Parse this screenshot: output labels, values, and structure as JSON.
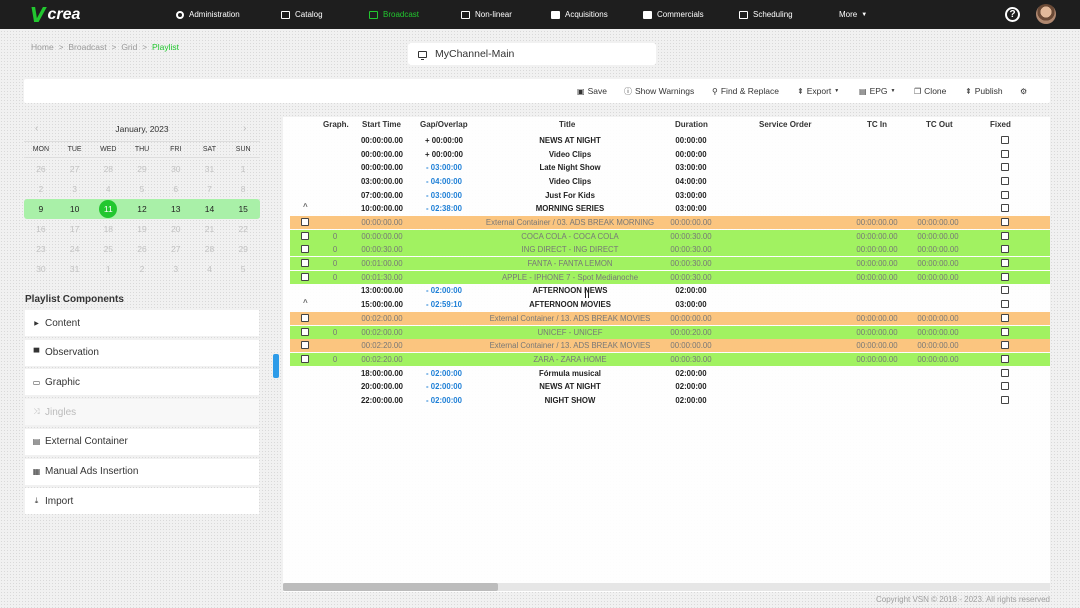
{
  "brand": {
    "logo_letter": "V",
    "logo_text": "crea",
    "accent": "#22c72f"
  },
  "nav": [
    {
      "label": "Administration",
      "icon": "gear-icon"
    },
    {
      "label": "Catalog",
      "icon": "folder-icon"
    },
    {
      "label": "Broadcast",
      "icon": "cast-icon",
      "active": true
    },
    {
      "label": "Non-linear",
      "icon": "play-icon"
    },
    {
      "label": "Acquisitions",
      "icon": "basket-icon"
    },
    {
      "label": "Commercials",
      "icon": "newspaper-icon"
    },
    {
      "label": "Scheduling",
      "icon": "calendar-icon"
    },
    {
      "label": "More",
      "icon": "caret-down-icon"
    }
  ],
  "help": {
    "label": "?"
  },
  "breadcrumb": {
    "home": "Home",
    "broadcast": "Broadcast",
    "grid": "Grid",
    "current": "Playlist",
    "sep": ">"
  },
  "channel": {
    "name": "MyChannel-Main"
  },
  "toolbar": {
    "save": "Save",
    "show_warnings": "Show Warnings",
    "find_replace": "Find & Replace",
    "export": "Export",
    "epg": "EPG",
    "clone": "Clone",
    "publish": "Publish"
  },
  "calendar": {
    "month": "January, 2023",
    "prev": "‹",
    "next": "›",
    "dow": [
      "MON",
      "TUE",
      "WED",
      "THU",
      "FRI",
      "SAT",
      "SUN"
    ],
    "weeks": [
      [
        "26",
        "27",
        "28",
        "29",
        "30",
        "31",
        "1"
      ],
      [
        "2",
        "3",
        "4",
        "5",
        "6",
        "7",
        "8"
      ],
      [
        "9",
        "10",
        "11",
        "12",
        "13",
        "14",
        "15"
      ],
      [
        "16",
        "17",
        "18",
        "19",
        "20",
        "21",
        "22"
      ],
      [
        "23",
        "24",
        "25",
        "26",
        "27",
        "28",
        "29"
      ],
      [
        "30",
        "31",
        "1",
        "2",
        "3",
        "4",
        "5"
      ]
    ],
    "selected_week": 2,
    "today": "11"
  },
  "components": {
    "title": "Playlist Components",
    "items": [
      {
        "label": "Content",
        "icon": "caret-right-icon"
      },
      {
        "label": "Observation",
        "icon": "comment-icon"
      },
      {
        "label": "Graphic",
        "icon": "monitor-icon"
      },
      {
        "label": "Jingles",
        "icon": "shuffle-icon",
        "disabled": true
      },
      {
        "label": "External Container",
        "icon": "container-icon"
      },
      {
        "label": "Manual Ads Insertion",
        "icon": "calendar-icon"
      },
      {
        "label": "Import",
        "icon": "download-icon"
      }
    ]
  },
  "grid": {
    "columns": {
      "graph": "Graph.",
      "start": "Start Time",
      "gap": "Gap/Overlap",
      "title": "Title",
      "duration": "Duration",
      "service": "Service Order",
      "tcin": "TC In",
      "tcout": "TC Out",
      "fixed": "Fixed"
    },
    "rows": [
      {
        "type": "plain",
        "start": "00:00:00.00",
        "gap": "+ 00:00:00",
        "title": "NEWS AT NIGHT",
        "duration": "00:00:00"
      },
      {
        "type": "plain",
        "start": "00:00:00.00",
        "gap": "+ 00:00:00",
        "title": "Video Clips",
        "duration": "00:00:00"
      },
      {
        "type": "plain",
        "start": "00:00:00.00",
        "gap": "- 03:00:00",
        "gap_blue": true,
        "title": "Late Night Show",
        "duration": "03:00:00"
      },
      {
        "type": "plain",
        "start": "03:00:00.00",
        "gap": "- 04:00:00",
        "gap_blue": true,
        "title": "Video Clips",
        "duration": "04:00:00"
      },
      {
        "type": "plain",
        "start": "07:00:00.00",
        "gap": "- 03:00:00",
        "gap_blue": true,
        "title": "Just For Kids",
        "duration": "03:00:00"
      },
      {
        "type": "plain",
        "start": "10:00:00.00",
        "gap": "- 02:38:00",
        "gap_blue": true,
        "title": "MORNING SERIES",
        "duration": "03:00:00",
        "chevron": "^"
      },
      {
        "type": "orange",
        "start": "00:00:00.00",
        "title": "External Container / 03. ADS BREAK MORNING",
        "duration": "00:00:00.00",
        "tcin": "00:00:00.00",
        "tcout": "00:00:00.00"
      },
      {
        "type": "green",
        "graph": "0",
        "start": "00:00:00.00",
        "title": "COCA COLA - COCA COLA",
        "duration": "00:00:30.00",
        "tcin": "00:00:00.00",
        "tcout": "00:00:00.00"
      },
      {
        "type": "green",
        "graph": "0",
        "start": "00:00:30.00",
        "title": "ING DIRECT - ING DIRECT",
        "duration": "00:00:30.00",
        "tcin": "00:00:00.00",
        "tcout": "00:00:00.00"
      },
      {
        "type": "green",
        "graph": "0",
        "start": "00:01:00.00",
        "title": "FANTA - FANTA LEMON",
        "duration": "00:00:30.00",
        "tcin": "00:00:00.00",
        "tcout": "00:00:00.00"
      },
      {
        "type": "green",
        "graph": "0",
        "start": "00:01:30.00",
        "title": "APPLE - IPHONE 7 - Spot Medianoche",
        "duration": "00:00:30.00",
        "tcin": "00:00:00.00",
        "tcout": "00:00:00.00"
      },
      {
        "type": "plain",
        "start": "13:00:00.00",
        "gap": "- 02:00:00",
        "gap_blue": true,
        "title": "AFTERNOON NEWS",
        "duration": "02:00:00"
      },
      {
        "type": "plain",
        "start": "15:00:00.00",
        "gap": "- 02:59:10",
        "gap_blue": true,
        "title": "AFTERNOON MOVIES",
        "duration": "03:00:00",
        "chevron": "^"
      },
      {
        "type": "orange",
        "start": "00:02:00.00",
        "title": "External Container / 13. ADS BREAK MOVIES",
        "duration": "00:00:00.00",
        "tcin": "00:00:00.00",
        "tcout": "00:00:00.00"
      },
      {
        "type": "green",
        "graph": "0",
        "start": "00:02:00.00",
        "title": "UNICEF - UNICEF",
        "duration": "00:00:20.00",
        "tcin": "00:00:00.00",
        "tcout": "00:00:00.00"
      },
      {
        "type": "orange",
        "start": "00:02:20.00",
        "title": "External Container / 13. ADS BREAK MOVIES",
        "duration": "00:00:00.00",
        "tcin": "00:00:00.00",
        "tcout": "00:00:00.00"
      },
      {
        "type": "green",
        "graph": "0",
        "start": "00:02:20.00",
        "title": "ZARA - ZARA HOME",
        "duration": "00:00:30.00",
        "tcin": "00:00:00.00",
        "tcout": "00:00:00.00"
      },
      {
        "type": "plain",
        "start": "18:00:00.00",
        "gap": "- 02:00:00",
        "gap_blue": true,
        "title": "Fórmula musical",
        "duration": "02:00:00"
      },
      {
        "type": "plain",
        "start": "20:00:00.00",
        "gap": "- 02:00:00",
        "gap_blue": true,
        "title": "NEWS AT NIGHT",
        "duration": "02:00:00"
      },
      {
        "type": "plain",
        "start": "22:00:00.00",
        "gap": "- 02:00:00",
        "gap_blue": true,
        "title": "NIGHT SHOW",
        "duration": "02:00:00"
      }
    ]
  },
  "footer": {
    "copyright": "Copyright VSN © 2018 - 2023. All rights reserved"
  }
}
